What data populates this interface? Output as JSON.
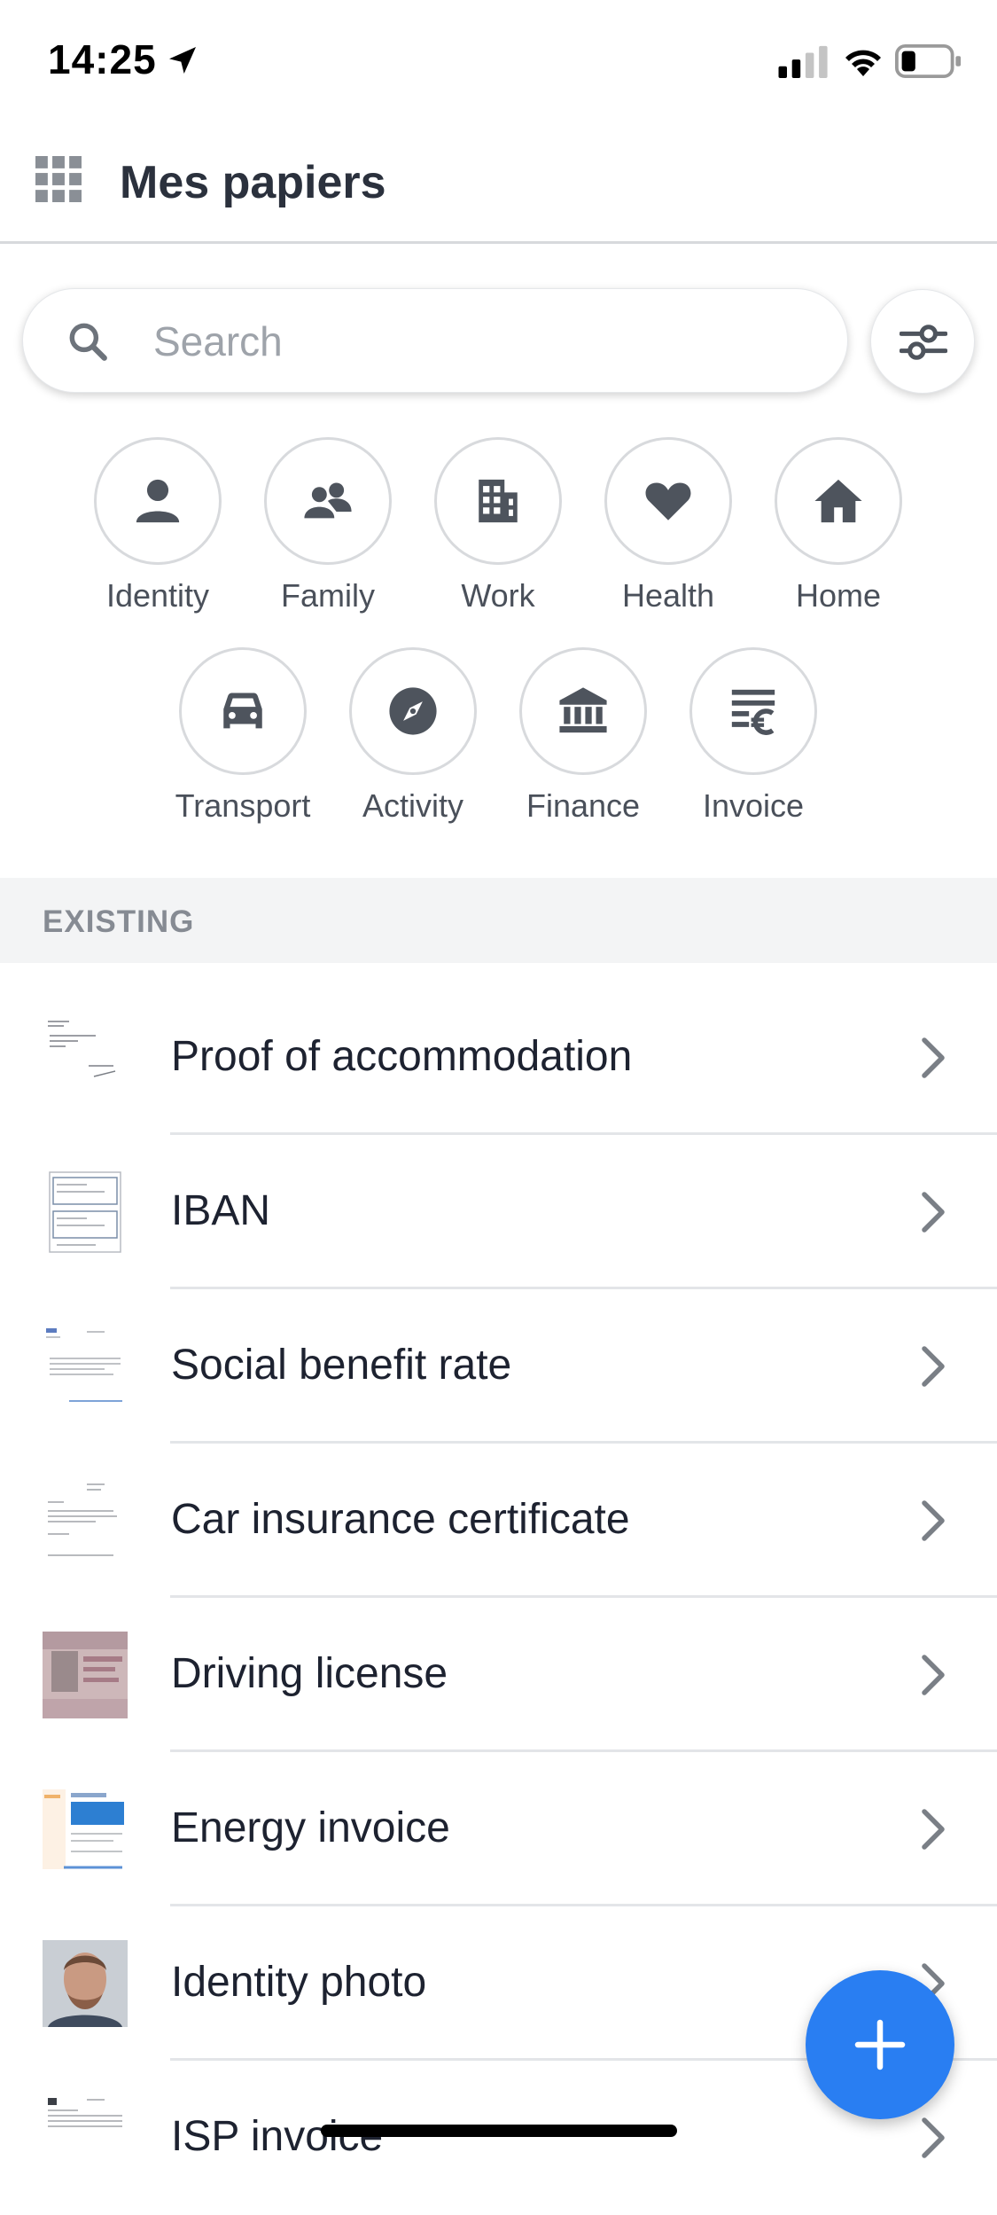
{
  "status_bar": {
    "time": "14:25",
    "icons": [
      "location-arrow-icon",
      "signal-icon",
      "wifi-icon",
      "battery-icon"
    ]
  },
  "header": {
    "title": "Mes papiers",
    "menu_icon": "apps-grid-icon"
  },
  "search": {
    "placeholder": "Search",
    "value": ""
  },
  "categories": [
    {
      "label": "Identity",
      "icon": "person-icon"
    },
    {
      "label": "Family",
      "icon": "family-icon"
    },
    {
      "label": "Work",
      "icon": "building-icon"
    },
    {
      "label": "Health",
      "icon": "heart-icon"
    },
    {
      "label": "Home",
      "icon": "house-icon"
    },
    {
      "label": "Transport",
      "icon": "car-icon"
    },
    {
      "label": "Activity",
      "icon": "compass-icon"
    },
    {
      "label": "Finance",
      "icon": "bank-icon"
    },
    {
      "label": "Invoice",
      "icon": "invoice-euro-icon"
    }
  ],
  "section": {
    "title": "EXISTING"
  },
  "documents": [
    {
      "label": "Proof of accommodation"
    },
    {
      "label": "IBAN"
    },
    {
      "label": "Social benefit rate"
    },
    {
      "label": "Car insurance certificate"
    },
    {
      "label": "Driving license"
    },
    {
      "label": "Energy invoice"
    },
    {
      "label": "Identity photo"
    },
    {
      "label": "ISP invoice"
    }
  ],
  "colors": {
    "accent": "#297ef2",
    "icon_gray": "#4e545d",
    "section_bg": "#f3f4f5"
  }
}
